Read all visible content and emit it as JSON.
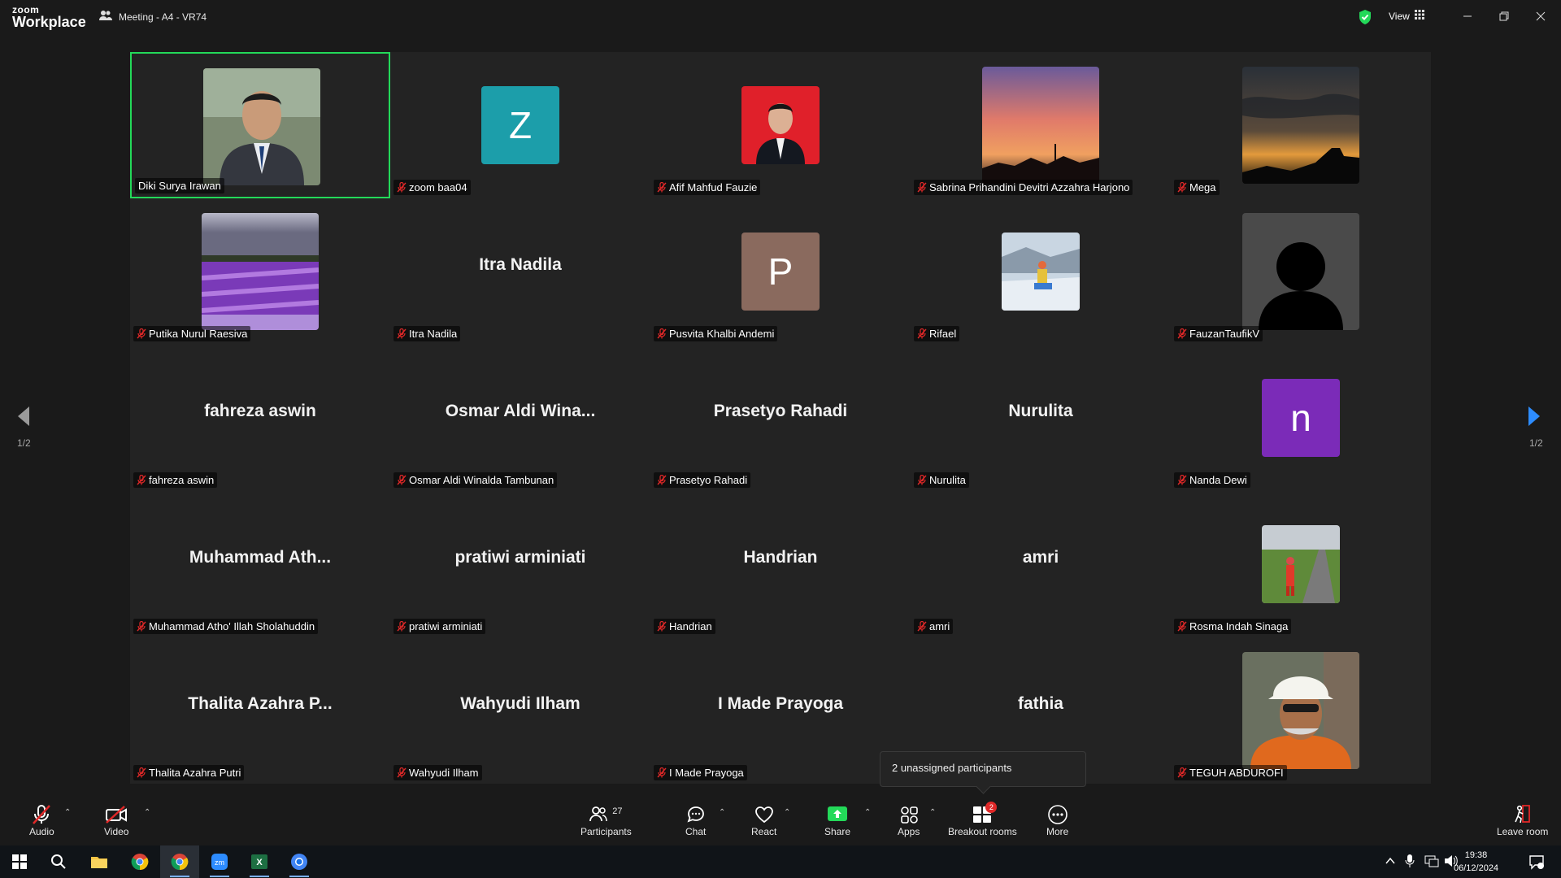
{
  "app": {
    "logo_line1": "zoom",
    "logo_line2": "Workplace",
    "meeting_title": "Meeting - A4 - VR74",
    "view_label": "View"
  },
  "pager": {
    "left": "1/2",
    "right": "1/2"
  },
  "participants": [
    {
      "label": "Diki Surya Irawan",
      "kind": "photo",
      "photo": "man-suit",
      "muted": false,
      "active": true
    },
    {
      "label": "zoom baa04",
      "kind": "letter",
      "letter": "Z",
      "color": "#1c9eaa",
      "muted": true
    },
    {
      "label": "Afif Mahfud Fauzie",
      "kind": "photo-sm",
      "photo": "red-portrait",
      "muted": true
    },
    {
      "label": "Sabrina Prihandini Devitri Azzahra Harjono",
      "kind": "photo",
      "photo": "sunset-pink",
      "muted": true
    },
    {
      "label": "Mega",
      "kind": "photo",
      "photo": "sunset-dark",
      "muted": true
    },
    {
      "label": "Putika Nurul Raesiva",
      "kind": "photo",
      "photo": "lavender",
      "muted": true
    },
    {
      "label": "Itra Nadila",
      "kind": "name",
      "big": "Itra Nadila",
      "muted": true
    },
    {
      "label": "Pusvita Khalbi Andemi",
      "kind": "letter",
      "letter": "P",
      "color": "#8a6a5e",
      "muted": true
    },
    {
      "label": "Rifael",
      "kind": "photo-sm",
      "photo": "snow",
      "muted": true
    },
    {
      "label": "FauzanTaufikV",
      "kind": "photo",
      "photo": "default-avatar",
      "muted": true
    },
    {
      "label": "fahreza aswin",
      "kind": "name",
      "big": "fahreza aswin",
      "muted": true
    },
    {
      "label": "Osmar Aldi Winalda Tambunan",
      "kind": "name",
      "big": "Osmar  Aldi  Wina...",
      "muted": true
    },
    {
      "label": "Prasetyo Rahadi",
      "kind": "name",
      "big": "Prasetyo Rahadi",
      "muted": true
    },
    {
      "label": "Nurulita",
      "kind": "name",
      "big": "Nurulita",
      "muted": true
    },
    {
      "label": "Nanda Dewi",
      "kind": "letter",
      "letter": "n",
      "color": "#7b2bb8",
      "muted": true
    },
    {
      "label": "Muhammad Atho' Illah Sholahuddin",
      "kind": "name",
      "big": "Muhammad  Ath...",
      "muted": true
    },
    {
      "label": "pratiwi arminiati",
      "kind": "name",
      "big": "pratiwi arminiati",
      "muted": true
    },
    {
      "label": "Handrian",
      "kind": "name",
      "big": "Handrian",
      "muted": true
    },
    {
      "label": "amri",
      "kind": "name",
      "big": "amri",
      "muted": true
    },
    {
      "label": "Rosma Indah Sinaga",
      "kind": "photo-sm",
      "photo": "road",
      "muted": true
    },
    {
      "label": "Thalita Azahra Putri",
      "kind": "name",
      "big": "Thalita Azahra P...",
      "muted": true
    },
    {
      "label": "Wahyudi Ilham",
      "kind": "name",
      "big": "Wahyudi Ilham",
      "muted": true
    },
    {
      "label": "I Made Prayoga",
      "kind": "name",
      "big": "I Made Prayoga",
      "muted": true
    },
    {
      "label": "fathia",
      "kind": "name",
      "big": "fathia",
      "muted": true
    },
    {
      "label": "TEGUH ABDUROFI",
      "kind": "photo",
      "photo": "helmet-man",
      "muted": true
    }
  ],
  "unassigned": "2 unassigned participants",
  "toolbar": {
    "audio": "Audio",
    "video": "Video",
    "participants": "Participants",
    "participants_count": "27",
    "chat": "Chat",
    "react": "React",
    "share": "Share",
    "apps": "Apps",
    "breakout": "Breakout rooms",
    "breakout_badge": "2",
    "more": "More",
    "leave": "Leave room"
  },
  "taskbar": {
    "time": "19:38",
    "date": "06/12/2024"
  },
  "colors": {
    "active_border": "#23d959",
    "share_green": "#23d959",
    "next_arrow": "#2d8cff"
  }
}
